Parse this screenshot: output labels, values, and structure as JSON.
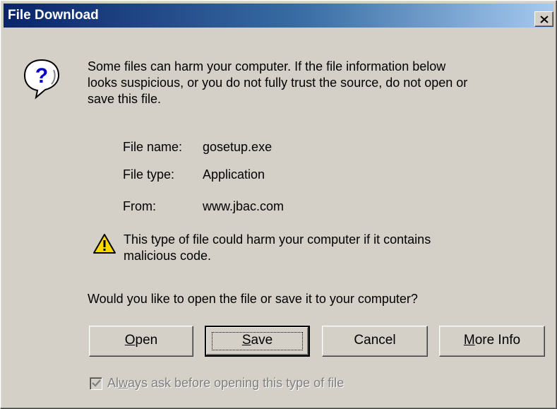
{
  "window": {
    "title": "File Download"
  },
  "warning": {
    "intro_line1": "Some files can harm your computer. If the file information below",
    "intro_line2": "looks suspicious, or you do not fully trust the source, do not open or",
    "intro_line3": "save this file.",
    "icon": "question-icon"
  },
  "file_info": {
    "name_label": "File name:",
    "name_value": "gosetup.exe",
    "type_label": "File type:",
    "type_value": "Application",
    "from_label": "From:",
    "from_value": "www.jbac.com"
  },
  "harm_notice": {
    "line1": "This type of file could harm your computer if it contains",
    "line2": "malicious code.",
    "icon": "warning-icon"
  },
  "prompt": "Would you like to open the file or save it to your computer?",
  "buttons": {
    "open": {
      "accel": "O",
      "rest": "pen"
    },
    "save": {
      "accel": "S",
      "rest": "ave"
    },
    "cancel": "Cancel",
    "more_info": {
      "accel": "M",
      "rest": "ore Info"
    }
  },
  "checkbox": {
    "pre": "Al",
    "accel": "w",
    "post": "ays ask before opening this type of file",
    "checked": true,
    "enabled": false
  },
  "colors": {
    "titlebar_start": "#0a246a",
    "titlebar_end": "#a6caf0",
    "face": "#d4d0c8"
  }
}
